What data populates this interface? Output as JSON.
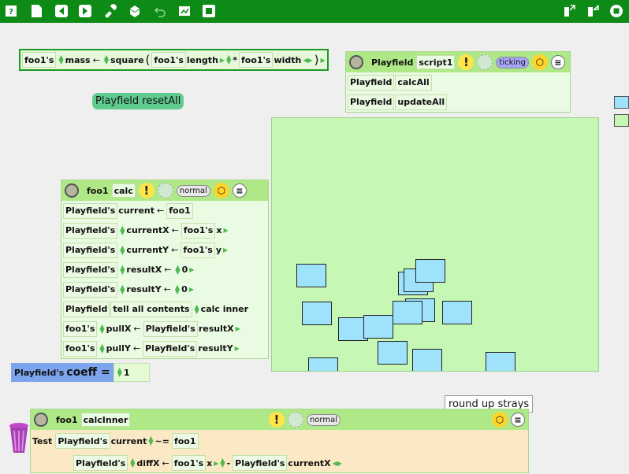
{
  "toolbar": {
    "buttons": [
      "help-icon",
      "new-page-icon",
      "back-icon",
      "forward-icon",
      "tools-icon",
      "supplies-icon",
      "undo-icon",
      "paint-icon",
      "fullscreen-icon"
    ],
    "right_buttons": [
      "publish-icon",
      "share-icon",
      "stop-icon"
    ]
  },
  "formula": {
    "obj1": "foo1's",
    "prop1": "mass",
    "func": "square",
    "open": "(",
    "obj2": "foo1's",
    "prop2": "length",
    "op": "*",
    "obj3": "foo1's",
    "prop3": "width",
    "close": ")"
  },
  "reset_button": {
    "label": "Playfield resetAll"
  },
  "script1": {
    "object": "Playfield",
    "name": "script1",
    "status": "ticking",
    "rows": [
      {
        "obj": "Playfield",
        "cmd": "calcAll"
      },
      {
        "obj": "Playfield",
        "cmd": "updateAll"
      }
    ]
  },
  "calc_script": {
    "object": "foo1",
    "name": "calc",
    "status": "normal",
    "rows": [
      {
        "a": "Playfield's",
        "b": "current",
        "c": "foo1"
      },
      {
        "a": "Playfield's",
        "b": "currentX",
        "c": "foo1's",
        "d": "x"
      },
      {
        "a": "Playfield's",
        "b": "currentY",
        "c": "foo1's",
        "d": "y"
      },
      {
        "a": "Playfield's",
        "b": "resultX",
        "c": "0"
      },
      {
        "a": "Playfield's",
        "b": "resultY",
        "c": "0"
      },
      {
        "a": "Playfield",
        "b": "tell all contents",
        "c": "calc inner"
      },
      {
        "a": "foo1's",
        "b": "pullX",
        "c": "Playfield's",
        "d": "resultX"
      },
      {
        "a": "foo1's",
        "b": "pullY",
        "c": "Playfield's",
        "d": "resultY"
      }
    ]
  },
  "coeff_watcher": {
    "owner": "Playfield's",
    "name": "coeff",
    "equals": "=",
    "value": "1"
  },
  "roundup_button": {
    "label": "round up strays"
  },
  "calcinner_script": {
    "object": "foo1",
    "name": "calcInner",
    "status": "normal",
    "test": {
      "label": "Test",
      "obj": "Playfield's",
      "prop": "current",
      "op": "~=",
      "val": "foo1"
    },
    "row2": {
      "obj": "Playfield's",
      "prop": "diffX",
      "obj2": "foo1's",
      "prop2": "x",
      "op": "-",
      "obj3": "Playfield's",
      "prop3": "currentX"
    }
  },
  "colors": {
    "toolbar": "#0d8b16",
    "playfield": "#c6f7b4",
    "shape": "#9ee3fb",
    "header": "#aee887"
  }
}
